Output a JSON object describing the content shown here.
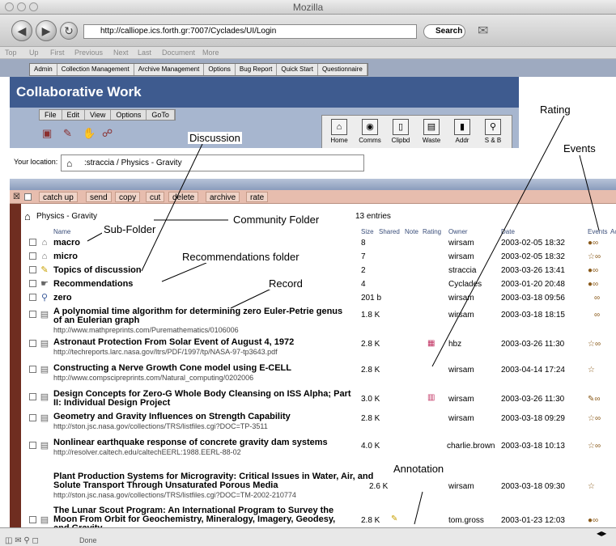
{
  "window": {
    "title": "Mozilla"
  },
  "toolbar": {
    "url": "http://calliope.ics.forth.gr:7007/Cyclades/UI/Login",
    "search_label": "Search"
  },
  "page_nav": {
    "items": [
      "Top",
      "Up",
      "First",
      "Previous",
      "Next",
      "Last",
      "Document",
      "More"
    ]
  },
  "top_tabs": {
    "items": [
      "Admin",
      "Collection Management",
      "Archive Management",
      "Options",
      "Bug Report",
      "Quick Start",
      "Questionnaire"
    ]
  },
  "header": {
    "title": "Collaborative Work"
  },
  "menu": {
    "items": [
      "File",
      "Edit",
      "View",
      "Options",
      "GoTo"
    ]
  },
  "apps": {
    "items": [
      "Home",
      "Comms",
      "Clipbd",
      "Waste",
      "Addr",
      "S & B"
    ]
  },
  "location": {
    "label": "Your location:",
    "path": ":straccia / Physics - Gravity"
  },
  "actions": {
    "items": [
      "catch up",
      "send",
      "copy",
      "cut",
      "delete",
      "archive",
      "rate"
    ]
  },
  "folder": {
    "name": "Physics - Gravity",
    "entries": "13 entries"
  },
  "columns": {
    "name": "Name",
    "size": "Size",
    "shared": "Shared",
    "note": "Note",
    "rating": "Rating",
    "owner": "Owner",
    "date": "Date",
    "events": "Events",
    "ac": "Ac"
  },
  "rows": [
    {
      "name": "macro",
      "sub": "",
      "size": "8",
      "owner": "wirsam",
      "date": "2003-02-05 18:32"
    },
    {
      "name": "micro",
      "sub": "",
      "size": "7",
      "owner": "wirsam",
      "date": "2003-02-05 18:32"
    },
    {
      "name": "Topics of discussion",
      "sub": "",
      "size": "2",
      "owner": "straccia",
      "date": "2003-03-26 13:41"
    },
    {
      "name": "Recommendations",
      "sub": "",
      "size": "4",
      "owner": "Cyclades",
      "date": "2003-01-20 20:48"
    },
    {
      "name": "zero",
      "sub": "",
      "size": "201 b",
      "owner": "wirsam",
      "date": "2003-03-18 09:56"
    },
    {
      "name": "A polynomial time algorithm for determining zero Euler-Petrie genus of an Eulerian graph",
      "sub": "http://www.mathpreprints.com/Puremathematics/0106006",
      "size": "1.8 K",
      "owner": "wirsam",
      "date": "2003-03-18 18:15"
    },
    {
      "name": "Astronaut Protection From Solar Event of August 4, 1972",
      "sub": "http://techreports.larc.nasa.gov/ltrs/PDF/1997/tp/NASA-97-tp3643.pdf",
      "size": "2.8 K",
      "owner": "hbz",
      "date": "2003-03-26 11:30"
    },
    {
      "name": "Constructing a Nerve Growth Cone model using E-CELL",
      "sub": "http://www.compscipreprints.com/Natural_computing/0202006",
      "size": "2.8 K",
      "owner": "wirsam",
      "date": "2003-04-14 17:24"
    },
    {
      "name": "Design Concepts for Zero-G Whole Body Cleansing on ISS Alpha; Part II: Individual Design Project",
      "sub": "",
      "size": "3.0 K",
      "owner": "wirsam",
      "date": "2003-03-26 11:30"
    },
    {
      "name": "Geometry and Gravity Influences on Strength Capability",
      "sub": "http://ston.jsc.nasa.gov/collections/TRS/listfiles.cgi?DOC=TP-3511",
      "size": "2.8 K",
      "owner": "wirsam",
      "date": "2003-03-18 09:29"
    },
    {
      "name": "Nonlinear earthquake response of concrete gravity dam systems",
      "sub": "http://resolver.caltech.edu/caltechEERL:1988.EERL-88-02",
      "size": "4.0 K",
      "owner": "charlie.brown",
      "date": "2003-03-18 10:13"
    },
    {
      "name": "Plant Production Systems for Microgravity: Critical Issues in Water, Air, and Solute Transport Through Unsaturated Porous Media",
      "sub": "http://ston.jsc.nasa.gov/collections/TRS/listfiles.cgi?DOC=TM-2002-210774",
      "size": "2.6 K",
      "owner": "wirsam",
      "date": "2003-03-18 09:30"
    },
    {
      "name": "The Lunar Scout Program: An International Program to Survey the Moon From Orbit for Geochemistry, Mineralogy, Imagery, Geodesy, and Gravity",
      "sub": "",
      "size": "2.8 K",
      "owner": "tom.gross",
      "date": "2003-01-23 12:03"
    }
  ],
  "annotations": {
    "discussion": "Discussion",
    "rating": "Rating",
    "events": "Events",
    "community_folder": "Community Folder",
    "sub_folder": "Sub-Folder",
    "recommendations_folder": "Recommendations folder",
    "record": "Record",
    "annotation": "Annotation"
  },
  "status": {
    "text": "Done"
  }
}
